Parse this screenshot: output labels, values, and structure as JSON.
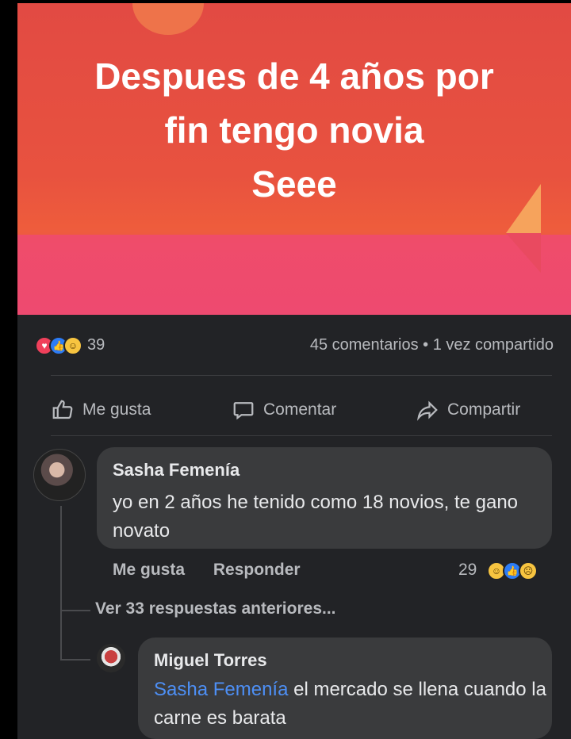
{
  "post": {
    "banner_lines": [
      "Despues de 4 años por",
      "fin tengo novia",
      "Seee"
    ],
    "reaction_count": "39",
    "stats_text": "45 comentarios • 1 vez compartido",
    "reaction_icons": [
      "love-icon",
      "like-icon",
      "haha-icon"
    ]
  },
  "actions": {
    "like": "Me gusta",
    "comment": "Comentar",
    "share": "Compartir"
  },
  "comments": [
    {
      "author": "Sasha Femenía",
      "text": "yo en 2 años he tenido como 18 novios, te gano novato",
      "like_label": "Me gusta",
      "reply_label": "Responder",
      "reaction_count": "29",
      "reaction_icons": [
        "haha-icon",
        "like-icon",
        "sad-icon"
      ]
    }
  ],
  "view_more": "Ver 33 respuestas anteriores...",
  "reply": {
    "author": "Miguel Torres",
    "mention": "Sasha Femenía",
    "text": " el mercado se llena cuando la carne es barata"
  },
  "colors": {
    "background": "#222326",
    "bubble": "#3a3b3d",
    "mention": "#4d8ff5",
    "banner_red": "#e24a43",
    "banner_pink": "#ef4c6a"
  }
}
